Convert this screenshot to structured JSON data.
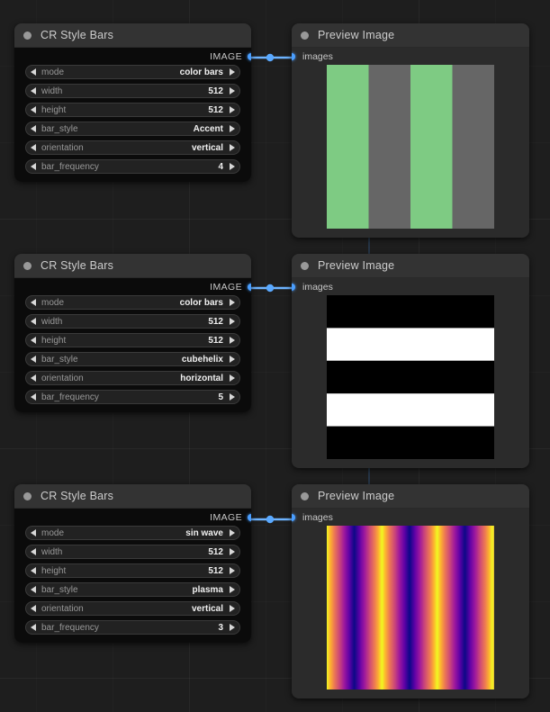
{
  "app": {
    "canvas_background": "#1e1e1e"
  },
  "colors": {
    "link": "#4a9eff",
    "port": "#4a9eff",
    "node_title_bg": "#333333",
    "node_body_bg": "#0b0b0b",
    "preview_body_bg": "#2b2b2b",
    "widget_bg": "#222222",
    "accent_green": "#7ecb83",
    "accent_gray": "#666666"
  },
  "nodes": [
    {
      "id": "bars-1",
      "title": "CR Style Bars",
      "output_label": "IMAGE",
      "widgets": [
        {
          "label": "mode",
          "value": "color bars"
        },
        {
          "label": "width",
          "value": "512"
        },
        {
          "label": "height",
          "value": "512"
        },
        {
          "label": "bar_style",
          "value": "Accent"
        },
        {
          "label": "orientation",
          "value": "vertical"
        },
        {
          "label": "bar_frequency",
          "value": "4"
        }
      ]
    },
    {
      "id": "bars-2",
      "title": "CR Style Bars",
      "output_label": "IMAGE",
      "widgets": [
        {
          "label": "mode",
          "value": "color bars"
        },
        {
          "label": "width",
          "value": "512"
        },
        {
          "label": "height",
          "value": "512"
        },
        {
          "label": "bar_style",
          "value": "cubehelix"
        },
        {
          "label": "orientation",
          "value": "horizontal"
        },
        {
          "label": "bar_frequency",
          "value": "5"
        }
      ]
    },
    {
      "id": "bars-3",
      "title": "CR Style Bars",
      "output_label": "IMAGE",
      "widgets": [
        {
          "label": "mode",
          "value": "sin wave"
        },
        {
          "label": "width",
          "value": "512"
        },
        {
          "label": "height",
          "value": "512"
        },
        {
          "label": "bar_style",
          "value": "plasma"
        },
        {
          "label": "orientation",
          "value": "vertical"
        },
        {
          "label": "bar_frequency",
          "value": "3"
        }
      ]
    }
  ],
  "previews": [
    {
      "id": "preview-1",
      "title": "Preview Image",
      "input_label": "images",
      "image": {
        "kind": "vertical-bars",
        "bars": [
          "#7ecb83",
          "#666666",
          "#7ecb83",
          "#666666"
        ]
      }
    },
    {
      "id": "preview-2",
      "title": "Preview Image",
      "input_label": "images",
      "image": {
        "kind": "horizontal-bars",
        "bars": [
          "#000000",
          "#ffffff",
          "#000000",
          "#ffffff",
          "#000000"
        ]
      }
    },
    {
      "id": "preview-3",
      "title": "Preview Image",
      "input_label": "images",
      "image": {
        "kind": "plasma-sin",
        "cycles": 3.5,
        "stops": [
          "#f0f921",
          "#fdb42f",
          "#ed7953",
          "#cc4778",
          "#9c179e",
          "#5c01a6",
          "#0d0887",
          "#5c01a6",
          "#9c179e",
          "#cc4778",
          "#ed7953",
          "#fdb42f",
          "#f0f921"
        ]
      }
    }
  ],
  "links": [
    {
      "from": "bars-1",
      "to": "preview-1"
    },
    {
      "from": "bars-2",
      "to": "preview-2"
    },
    {
      "from": "bars-3",
      "to": "preview-3"
    }
  ]
}
